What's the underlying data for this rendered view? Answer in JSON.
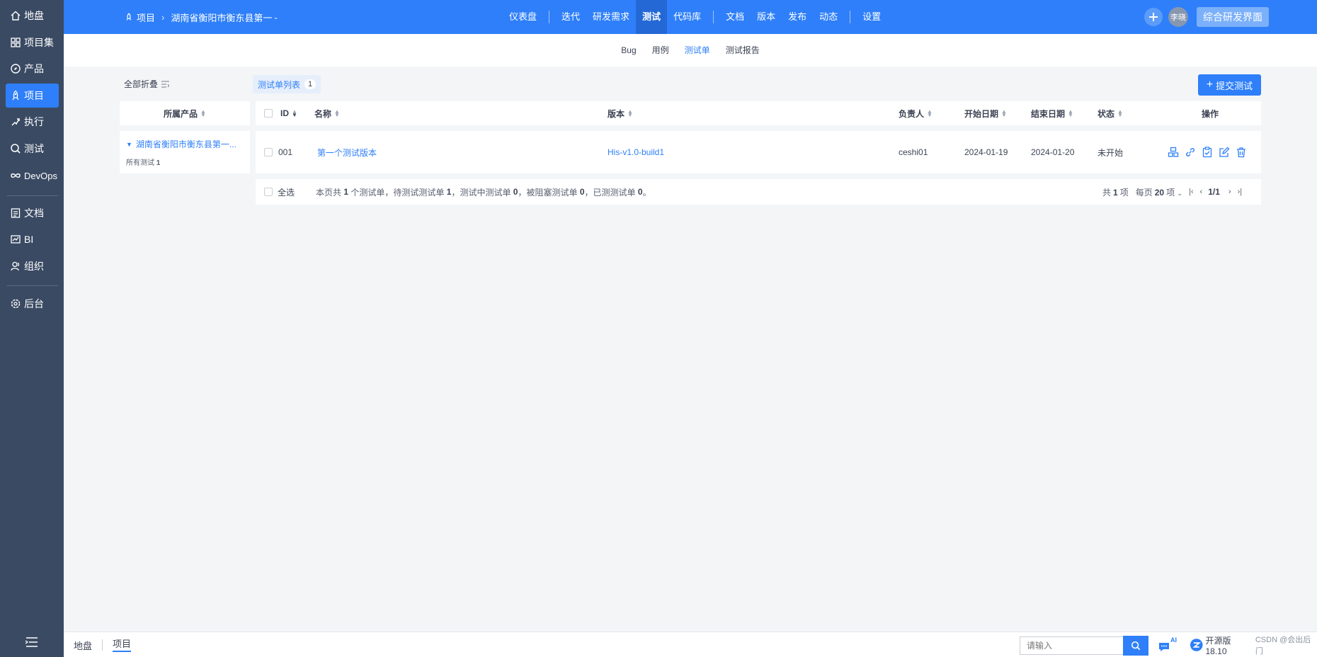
{
  "sidebar": {
    "items": [
      {
        "label": "地盘",
        "icon": "home-icon"
      },
      {
        "label": "项目集",
        "icon": "grid-icon"
      },
      {
        "label": "产品",
        "icon": "compass-icon"
      },
      {
        "label": "项目",
        "icon": "rocket-icon",
        "active": true
      },
      {
        "label": "执行",
        "icon": "run-icon"
      },
      {
        "label": "测试",
        "icon": "search-icon"
      },
      {
        "label": "DevOps",
        "icon": "infinity-icon"
      },
      {
        "label": "文档",
        "icon": "doc-icon"
      },
      {
        "label": "BI",
        "icon": "chart-icon"
      },
      {
        "label": "组织",
        "icon": "people-icon"
      },
      {
        "label": "后台",
        "icon": "gear-icon"
      }
    ]
  },
  "topbar": {
    "breadcrumb": [
      "项目",
      "湖南省衡阳市衡东县第一人"
    ],
    "nav": [
      "仪表盘",
      "迭代",
      "研发需求",
      "测试",
      "代码库",
      "文档",
      "版本",
      "发布",
      "动态",
      "设置"
    ],
    "active_nav": "测试",
    "user_name": "李晓",
    "view_switch": "综合研发界面"
  },
  "subnav": {
    "items": [
      "Bug",
      "用例",
      "测试单",
      "测试报告"
    ],
    "active": "测试单"
  },
  "toolbar": {
    "collapse_all": "全部折叠",
    "list_tab": "测试单列表",
    "list_count": "1",
    "submit_button": "提交测试"
  },
  "product_tree": {
    "header": "所属产品",
    "node_title": "湖南省衡阳市衡东县第一...",
    "node_sub_label": "所有测试",
    "node_sub_count": "1"
  },
  "table": {
    "columns": {
      "id": "ID",
      "name": "名称",
      "build": "版本",
      "owner": "负责人",
      "begin": "开始日期",
      "end": "结束日期",
      "status": "状态",
      "actions": "操作"
    },
    "rows": [
      {
        "id": "001",
        "name": "第一个测试版本",
        "build": "His-v1.0-build1",
        "owner": "ceshi01",
        "begin": "2024-01-19",
        "end": "2024-01-20",
        "status": "未开始"
      }
    ],
    "footer": {
      "select_all": "全选",
      "summary": {
        "p1": "本页共",
        "n1": "1",
        "p2": "个测试单，待测试测试单",
        "n2": "1",
        "p3": "，测试中测试单",
        "n3": "0",
        "p4": "，被阻塞测试单",
        "n4": "0",
        "p5": "，已测测试单",
        "n5": "0",
        "p6": "。"
      },
      "total_prefix": "共",
      "total": "1",
      "total_suffix": "项",
      "per_page_prefix": "每页",
      "per_page": "20",
      "per_page_suffix": "项",
      "page": "1/1"
    }
  },
  "bottombar": {
    "crumbs": [
      "地盘",
      "项目"
    ],
    "search_placeholder": "请输入",
    "ai_label": "AI",
    "version": "开源版18.10",
    "watermark": "CSDN @会出后门"
  },
  "colors": {
    "primary": "#2e7ff9",
    "sidebar": "#3a4a63",
    "page_bg": "#f4f5f7"
  }
}
